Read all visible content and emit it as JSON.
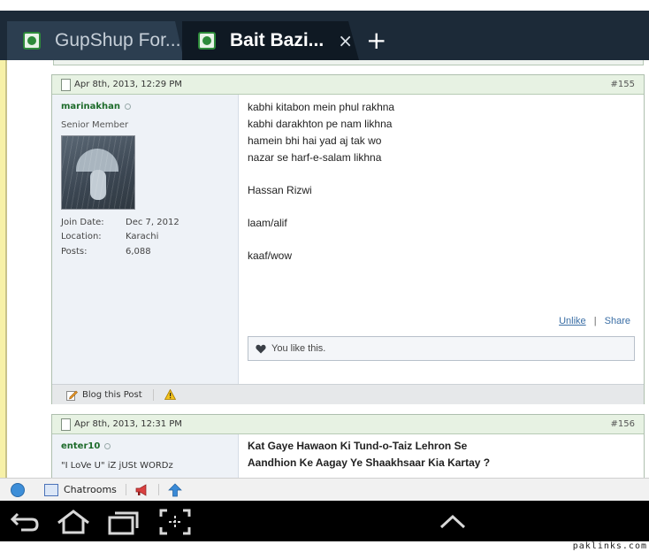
{
  "browser": {
    "tabs": [
      {
        "title": "GupShup For...",
        "active": false
      },
      {
        "title": "Bait Bazi...",
        "active": true
      }
    ],
    "close_symbol": "×",
    "new_tab_symbol": "+"
  },
  "posts": [
    {
      "date": "Apr 8th, 2013, 12:29 PM",
      "number": "#155",
      "username": "marinakhan",
      "user_title": "Senior Member",
      "avatar": "rain-umbrella-sketch",
      "stats": [
        {
          "label": "Join Date:",
          "value": "Dec 7, 2012"
        },
        {
          "label": "Location:",
          "value": "Karachi"
        },
        {
          "label": "Posts:",
          "value": "6,088"
        }
      ],
      "message": {
        "verse": [
          "kabhi kitabon mein phul rakhna",
          "kabhi darakhton pe nam likhna",
          "hamein bhi hai yad aj tak wo",
          "nazar se harf-e-salam likhna"
        ],
        "author": "Hassan Rizwi",
        "tag1": "laam/alif",
        "tag2": "kaaf/wow"
      },
      "actions": {
        "unlike": "Unlike",
        "divider": "|",
        "share": "Share"
      },
      "like_text": "You like this.",
      "footer": {
        "blog": "Blog this Post"
      }
    },
    {
      "date": "Apr 8th, 2013, 12:31 PM",
      "number": "#156",
      "username": "enter10",
      "user_title": "\"I LoVe U\" iZ jUSt WORDz",
      "message": {
        "line1": "Kat Gaye Hawaon Ki Tund-o-Taiz Lehron Se",
        "line2": "Aandhion Ke Aagay Ye Shaakhsaar Kia Kartay ?"
      }
    }
  ],
  "chatbar": {
    "chatrooms": "Chatrooms"
  },
  "watermark": "paklinks.com",
  "colors": {
    "chrome_dark": "#1c2a38",
    "active_tab": "#0f1923",
    "post_header": "#e7f2e3",
    "username": "#1d6b2a",
    "link": "#3a6ea5"
  }
}
